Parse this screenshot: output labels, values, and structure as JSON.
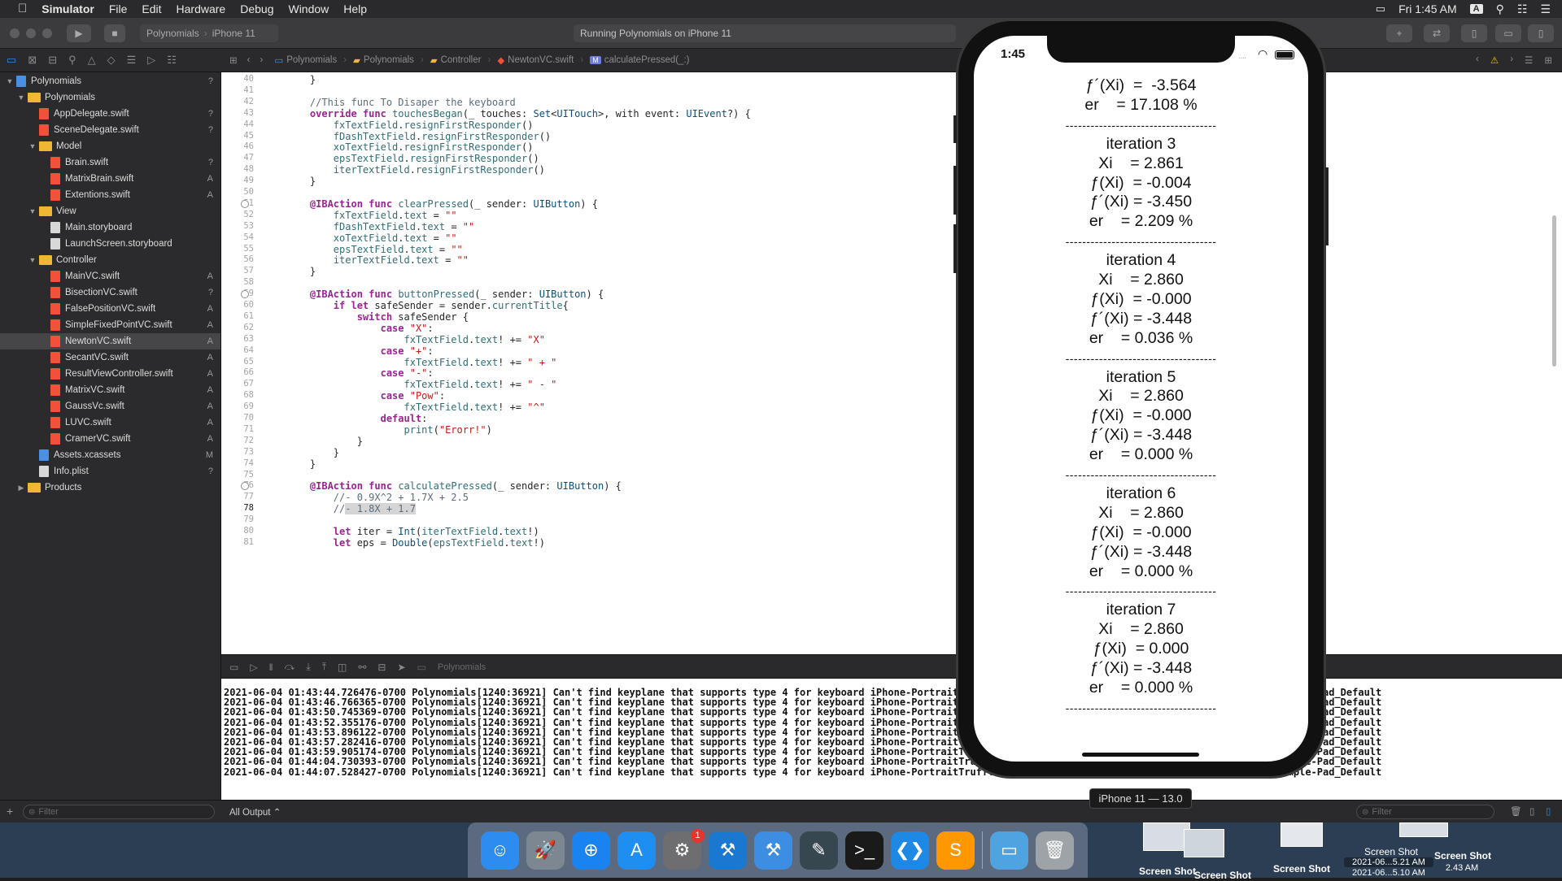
{
  "menubar": {
    "apple_icon": "apple-icon",
    "app": "Simulator",
    "items": [
      "File",
      "Edit",
      "Hardware",
      "Debug",
      "Window",
      "Help"
    ],
    "clock": "Fri 1:45 AM",
    "user_initial": "A"
  },
  "toolbar": {
    "scheme": "Polynomials",
    "device": "iPhone 11",
    "status": "Running Polynomials on iPhone 11"
  },
  "jumpbar": [
    "Polynomials",
    "Polynomials",
    "Controller",
    "NewtonVC.swift",
    "calculatePressed(_:)"
  ],
  "navigator": {
    "rows": [
      {
        "label": "Polynomials",
        "kind": "project",
        "indent": 0,
        "open": true,
        "status": "?"
      },
      {
        "label": "Polynomials",
        "kind": "folder",
        "indent": 1,
        "open": true,
        "status": ""
      },
      {
        "label": "AppDelegate.swift",
        "kind": "swift",
        "indent": 2,
        "status": "?"
      },
      {
        "label": "SceneDelegate.swift",
        "kind": "swift",
        "indent": 2,
        "status": "?"
      },
      {
        "label": "Model",
        "kind": "folder",
        "indent": 2,
        "open": true,
        "status": ""
      },
      {
        "label": "Brain.swift",
        "kind": "swift",
        "indent": 3,
        "status": "?"
      },
      {
        "label": "MatrixBrain.swift",
        "kind": "swift",
        "indent": 3,
        "status": "A"
      },
      {
        "label": "Extentions.swift",
        "kind": "swift",
        "indent": 3,
        "status": "A"
      },
      {
        "label": "View",
        "kind": "folder",
        "indent": 2,
        "open": true,
        "status": ""
      },
      {
        "label": "Main.storyboard",
        "kind": "storyboard",
        "indent": 3,
        "status": ""
      },
      {
        "label": "LaunchScreen.storyboard",
        "kind": "storyboard",
        "indent": 3,
        "status": ""
      },
      {
        "label": "Controller",
        "kind": "folder",
        "indent": 2,
        "open": true,
        "status": ""
      },
      {
        "label": "MainVC.swift",
        "kind": "swift",
        "indent": 3,
        "status": "A"
      },
      {
        "label": "BisectionVC.swift",
        "kind": "swift",
        "indent": 3,
        "status": "?"
      },
      {
        "label": "FalsePositionVC.swift",
        "kind": "swift",
        "indent": 3,
        "status": "A"
      },
      {
        "label": "SimpleFixedPointVC.swift",
        "kind": "swift",
        "indent": 3,
        "status": "A"
      },
      {
        "label": "NewtonVC.swift",
        "kind": "swift",
        "indent": 3,
        "status": "A",
        "selected": true
      },
      {
        "label": "SecantVC.swift",
        "kind": "swift",
        "indent": 3,
        "status": "A"
      },
      {
        "label": "ResultViewController.swift",
        "kind": "swift",
        "indent": 3,
        "status": "A"
      },
      {
        "label": "MatrixVC.swift",
        "kind": "swift",
        "indent": 3,
        "status": "A"
      },
      {
        "label": "GaussVc.swift",
        "kind": "swift",
        "indent": 3,
        "status": "A"
      },
      {
        "label": "LUVC.swift",
        "kind": "swift",
        "indent": 3,
        "status": "A"
      },
      {
        "label": "CramerVC.swift",
        "kind": "swift",
        "indent": 3,
        "status": "A"
      },
      {
        "label": "Assets.xcassets",
        "kind": "assets",
        "indent": 2,
        "status": "M"
      },
      {
        "label": "Info.plist",
        "kind": "plist",
        "indent": 2,
        "status": "?"
      },
      {
        "label": "Products",
        "kind": "folder",
        "indent": 1,
        "open": false,
        "status": ""
      }
    ],
    "filter_placeholder": "Filter"
  },
  "editor": {
    "current_line": 78,
    "breakpoint_lines": [
      51,
      59,
      76
    ],
    "lines": [
      {
        "n": 40,
        "html": "    }"
      },
      {
        "n": 41,
        "html": ""
      },
      {
        "n": 42,
        "html": "    <span class='cm'>//This func To Disaper the keyboard</span>"
      },
      {
        "n": 43,
        "html": "    <span class='kw'>override</span> <span class='kw'>func</span> <span class='fn'>touchesBegan</span>(_ touches: <span class='ty'>Set</span>&lt;<span class='ty'>UITouch</span>&gt;, with event: <span class='ty'>UIEvent</span>?) {"
      },
      {
        "n": 44,
        "html": "        <span class='fn'>fxTextField</span>.<span class='fn'>resignFirstResponder</span>()"
      },
      {
        "n": 45,
        "html": "        <span class='fn'>fDashTextField</span>.<span class='fn'>resignFirstResponder</span>()"
      },
      {
        "n": 46,
        "html": "        <span class='fn'>xoTextField</span>.<span class='fn'>resignFirstResponder</span>()"
      },
      {
        "n": 47,
        "html": "        <span class='fn'>epsTextField</span>.<span class='fn'>resignFirstResponder</span>()"
      },
      {
        "n": 48,
        "html": "        <span class='fn'>iterTextField</span>.<span class='fn'>resignFirstResponder</span>()"
      },
      {
        "n": 49,
        "html": "    }"
      },
      {
        "n": 50,
        "html": ""
      },
      {
        "n": 51,
        "html": "    <span class='kw'>@IBAction</span> <span class='kw'>func</span> <span class='fn'>clearPressed</span>(_ sender: <span class='ty'>UIButton</span>) {"
      },
      {
        "n": 52,
        "html": "        <span class='fn'>fxTextField</span>.<span class='fn'>text</span> = <span class='str'>\"\"</span>"
      },
      {
        "n": 53,
        "html": "        <span class='fn'>fDashTextField</span>.<span class='fn'>text</span> = <span class='str'>\"\"</span>"
      },
      {
        "n": 54,
        "html": "        <span class='fn'>xoTextField</span>.<span class='fn'>text</span> = <span class='str'>\"\"</span>"
      },
      {
        "n": 55,
        "html": "        <span class='fn'>epsTextField</span>.<span class='fn'>text</span> = <span class='str'>\"\"</span>"
      },
      {
        "n": 56,
        "html": "        <span class='fn'>iterTextField</span>.<span class='fn'>text</span> = <span class='str'>\"\"</span>"
      },
      {
        "n": 57,
        "html": "    }"
      },
      {
        "n": 58,
        "html": ""
      },
      {
        "n": 59,
        "html": "    <span class='kw'>@IBAction</span> <span class='kw'>func</span> <span class='fn'>buttonPressed</span>(_ sender: <span class='ty'>UIButton</span>) {"
      },
      {
        "n": 60,
        "html": "        <span class='kw'>if</span> <span class='kw'>let</span> safeSender = sender.<span class='fn'>currentTitle</span>{"
      },
      {
        "n": 61,
        "html": "            <span class='kw'>switch</span> safeSender {"
      },
      {
        "n": 62,
        "html": "                <span class='kw'>case</span> <span class='str'>\"X\"</span>:"
      },
      {
        "n": 63,
        "html": "                    <span class='fn'>fxTextField</span>.<span class='fn'>text</span>! += <span class='str'>\"X\"</span>"
      },
      {
        "n": 64,
        "html": "                <span class='kw'>case</span> <span class='str'>\"+\"</span>:"
      },
      {
        "n": 65,
        "html": "                    <span class='fn'>fxTextField</span>.<span class='fn'>text</span>! += <span class='str'>\" + \"</span>"
      },
      {
        "n": 66,
        "html": "                <span class='kw'>case</span> <span class='str'>\"-\"</span>:"
      },
      {
        "n": 67,
        "html": "                    <span class='fn'>fxTextField</span>.<span class='fn'>text</span>! += <span class='str'>\" - \"</span>"
      },
      {
        "n": 68,
        "html": "                <span class='kw'>case</span> <span class='str'>\"Pow\"</span>:"
      },
      {
        "n": 69,
        "html": "                    <span class='fn'>fxTextField</span>.<span class='fn'>text</span>! += <span class='str'>\"^\"</span>"
      },
      {
        "n": 70,
        "html": "                <span class='kw'>default</span>:"
      },
      {
        "n": 71,
        "html": "                    <span class='fn'>print</span>(<span class='str'>\"Erorr!\"</span>)"
      },
      {
        "n": 72,
        "html": "            }"
      },
      {
        "n": 73,
        "html": "        }"
      },
      {
        "n": 74,
        "html": "    }"
      },
      {
        "n": 75,
        "html": ""
      },
      {
        "n": 76,
        "html": "    <span class='kw'>@IBAction</span> <span class='kw'>func</span> <span class='fn'>calculatePressed</span>(_ sender: <span class='ty'>UIButton</span>) {"
      },
      {
        "n": 77,
        "html": "        <span class='cm'>//- 0.9X^2 + 1.7X + 2.5</span>"
      },
      {
        "n": 78,
        "html": "        <span class='cm'>//<span class='sel-h'>- 1.8X + 1.7</span></span>"
      },
      {
        "n": 79,
        "html": ""
      },
      {
        "n": 80,
        "html": "        <span class='kw'>let</span> iter = <span class='ty'>Int</span>(<span class='fn'>iterTextField</span>.<span class='fn'>text</span>!)"
      },
      {
        "n": 81,
        "html": "        <span class='kw'>let</span> eps = <span class='ty'>Double</span>(<span class='fn'>epsTextField</span>.<span class='fn'>text</span>!)"
      }
    ]
  },
  "debug": {
    "target": "Polynomials"
  },
  "console": {
    "lines": [
      "2021-06-04 01:43:44.726476-0700 Polynomials[1240:36921] Can't find keyplane that supports type 4 for keyboard iPhone-PortraitTruffle-NumberPad; using 25683_PortraitTruffle_iPhone-Simple-Pad_Default",
      "2021-06-04 01:43:46.766365-0700 Polynomials[1240:36921] Can't find keyplane that supports type 4 for keyboard iPhone-PortraitTruffle-NumberPad; using 25683_PortraitTruffle_iPhone-Simple-Pad_Default",
      "2021-06-04 01:43:50.745369-0700 Polynomials[1240:36921] Can't find keyplane that supports type 4 for keyboard iPhone-PortraitTruffle-NumberPad; using 25683_PortraitTruffle_iPhone-Simple-Pad_Default",
      "2021-06-04 01:43:52.355176-0700 Polynomials[1240:36921] Can't find keyplane that supports type 4 for keyboard iPhone-PortraitTruffle-NumberPad; using 25683_PortraitTruffle_iPhone-Simple-Pad_Default",
      "2021-06-04 01:43:53.896122-0700 Polynomials[1240:36921] Can't find keyplane that supports type 4 for keyboard iPhone-PortraitTruffle-NumberPad; using 25683_PortraitTruffle_iPhone-Simple-Pad_Default",
      "2021-06-04 01:43:57.282416-0700 Polynomials[1240:36921] Can't find keyplane that supports type 4 for keyboard iPhone-PortraitTruffle-NumberPad; using 25683_PortraitTruffle_iPhone-Simple-Pad_Default",
      "2021-06-04 01:43:59.905174-0700 Polynomials[1240:36921] Can't find keyplane that supports type 4 for keyboard iPhone-PortraitTruffle-NumberPad; using 25683_PortraitTruffle_iPhone-Simple-Pad_Default",
      "2021-06-04 01:44:04.730393-0700 Polynomials[1240:36921] Can't find keyplane that supports type 4 for keyboard iPhone-PortraitTruffle-NumberPad; using 25683_PortraitTruffle_iPhone-Simple-Pad_Default",
      "2021-06-04 01:44:07.528427-0700 Polynomials[1240:36921] Can't find keyplane that supports type 4 for keyboard iPhone-PortraitTruffle-NumberPad; using 25683_PortraitTruffle_iPhone-Simple-Pad_Default"
    ],
    "output_selector": "All Output ⌃",
    "filter_placeholder": "Filter"
  },
  "simulator": {
    "time": "1:45",
    "device_label": "iPhone 11 — 13.0",
    "top_partial": [
      "ƒ´(Xi)  =  -3.564",
      "er    = 17.108 %"
    ],
    "separator": "------------------------------------",
    "iterations": [
      {
        "title": "iteration 3",
        "xi": "Xi    = 2.861",
        "fx": "ƒ(Xi)  = -0.004",
        "fdx": "ƒ´(Xi) = -3.450",
        "er": "er    = 2.209 %"
      },
      {
        "title": "iteration 4",
        "xi": "Xi    = 2.860",
        "fx": "ƒ(Xi)  = -0.000",
        "fdx": "ƒ´(Xi) = -3.448",
        "er": "er    = 0.036 %"
      },
      {
        "title": "iteration 5",
        "xi": "Xi    = 2.860",
        "fx": "ƒ(Xi)  = -0.000",
        "fdx": "ƒ´(Xi) = -3.448",
        "er": "er    = 0.000 %"
      },
      {
        "title": "iteration 6",
        "xi": "Xi    = 2.860",
        "fx": "ƒ(Xi)  = -0.000",
        "fdx": "ƒ´(Xi) = -3.448",
        "er": "er    = 0.000 %"
      },
      {
        "title": "iteration 7",
        "xi": "Xi    = 2.860",
        "fx": "ƒ(Xi)  = 0.000",
        "fdx": "ƒ´(Xi) = -3.448",
        "er": "er    = 0.000 %"
      }
    ]
  },
  "dock": {
    "apps": [
      {
        "name": "finder-icon",
        "color": "#2d8cf0",
        "glyph": "☺"
      },
      {
        "name": "launchpad-icon",
        "color": "#7d8792",
        "glyph": "🚀"
      },
      {
        "name": "safari-icon",
        "color": "#1a83f2",
        "glyph": "⊕"
      },
      {
        "name": "app-store-icon",
        "color": "#1f8ef1",
        "glyph": "A"
      },
      {
        "name": "system-preferences-icon",
        "color": "#6e6e70",
        "glyph": "⚙"
      },
      {
        "name": "xcode-icon",
        "color": "#1b78d0",
        "glyph": "⚒"
      },
      {
        "name": "xcode-beta-icon",
        "color": "#3d8ee2",
        "glyph": "⚒"
      },
      {
        "name": "script-editor-icon",
        "color": "#37474f",
        "glyph": "✎"
      },
      {
        "name": "terminal-icon",
        "color": "#1a1a1a",
        "glyph": ">_"
      },
      {
        "name": "vscode-icon",
        "color": "#1e88e5",
        "glyph": "❮❯"
      },
      {
        "name": "sublime-icon",
        "color": "#ff9800",
        "glyph": "S"
      },
      {
        "name": "downloads-folder-icon",
        "color": "#4fa3e0",
        "glyph": "▭"
      },
      {
        "name": "trash-icon",
        "color": "#9ea3a8",
        "glyph": "🗑"
      }
    ],
    "notification_badge": "1"
  },
  "desktop": {
    "screenshots": [
      {
        "label": "Screen Shot"
      },
      {
        "label": "Screen Shot"
      },
      {
        "label": "Screen Shot"
      },
      {
        "label": "Screen Shot"
      },
      {
        "label": "Screen Shot"
      }
    ],
    "shot_meta_1": "2021-06...5.21 AM",
    "shot_meta_2": "2021-06...5.10 AM",
    "shot_meta_3": "2.43 AM"
  }
}
